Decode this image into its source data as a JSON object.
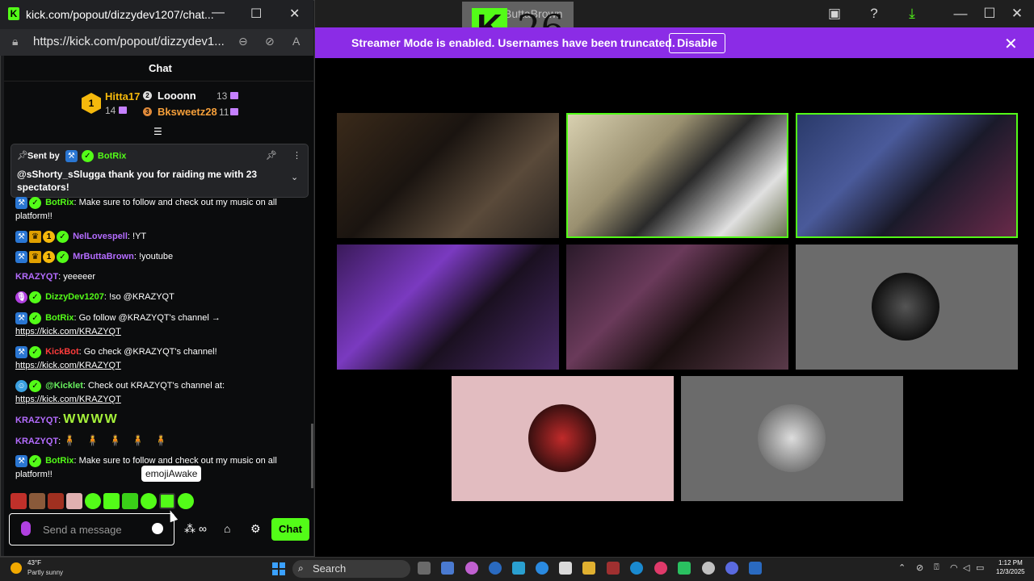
{
  "app_window": {
    "title": "ButtaBrown",
    "logo_number": "26",
    "buttons": {
      "minimize": "—",
      "maximize": "☐",
      "close": "✕"
    }
  },
  "banner": {
    "text": "Streamer Mode is enabled. Usernames have been truncated.",
    "button_label": "Disable",
    "close": "✕",
    "color": "#8b2ce6"
  },
  "popout": {
    "window_title": "kick.com/popout/dizzydev1207/chat...",
    "url": "https://kick.com/popout/dizzydev1...",
    "chat_header": "Chat"
  },
  "leaderboard": {
    "rank1": "1",
    "entries": [
      {
        "name": "Hitta17",
        "count": "14",
        "color": "#f5b90c"
      },
      {
        "name": "Looonn",
        "count": "13",
        "color": "#ffffff"
      },
      {
        "name": "Bksweetz28",
        "count": "11",
        "color": "#f59f3a"
      }
    ]
  },
  "pinned": {
    "sent_by_label": "Sent by",
    "sender": "BotRix",
    "text": "@sShorty_sSlugga thank you for raiding me with 23 spectators!"
  },
  "messages": [
    {
      "user": "BotRix",
      "text": ": Make sure to follow and check out my music on all platform!!"
    },
    {
      "user": "NelLovespell",
      "text": ": !YT"
    },
    {
      "user": "MrButtaBrown",
      "text": ": !youtube"
    },
    {
      "user": "KRAZYQT",
      "text": ": yeeeeer"
    },
    {
      "user": "DizzyDev1207",
      "text": ": !so @KRAZYQT"
    },
    {
      "user": "BotRix",
      "text": ": Go follow @KRAZYQT's channel →",
      "link": "https://kick.com/KRAZYQT"
    },
    {
      "user": "KickBot",
      "text": ": Go check @KRAZYQT's channel!",
      "link": "https://kick.com/KRAZYQT"
    },
    {
      "user": "@Kicklet",
      "text": ": Check out KRAZYQT's channel at:",
      "link": "https://kick.com/KRAZYQT"
    },
    {
      "user": "KRAZYQT",
      "text": ":",
      "emotes": "WWWW"
    },
    {
      "user": "KRAZYQT",
      "text": ":",
      "emotes": "🧍🧍🧍🧍🧍"
    },
    {
      "user": "BotRix",
      "text": ": Make sure to follow and check out my music on all platform!!"
    }
  ],
  "tooltip": "emojiAwake",
  "composer": {
    "placeholder": "Send a message",
    "send_label": "Chat"
  },
  "taskbar": {
    "temperature": "43°F",
    "weather": "Partly sunny",
    "search": "Search",
    "time": "1:12 PM",
    "date": "12/3/2025"
  }
}
